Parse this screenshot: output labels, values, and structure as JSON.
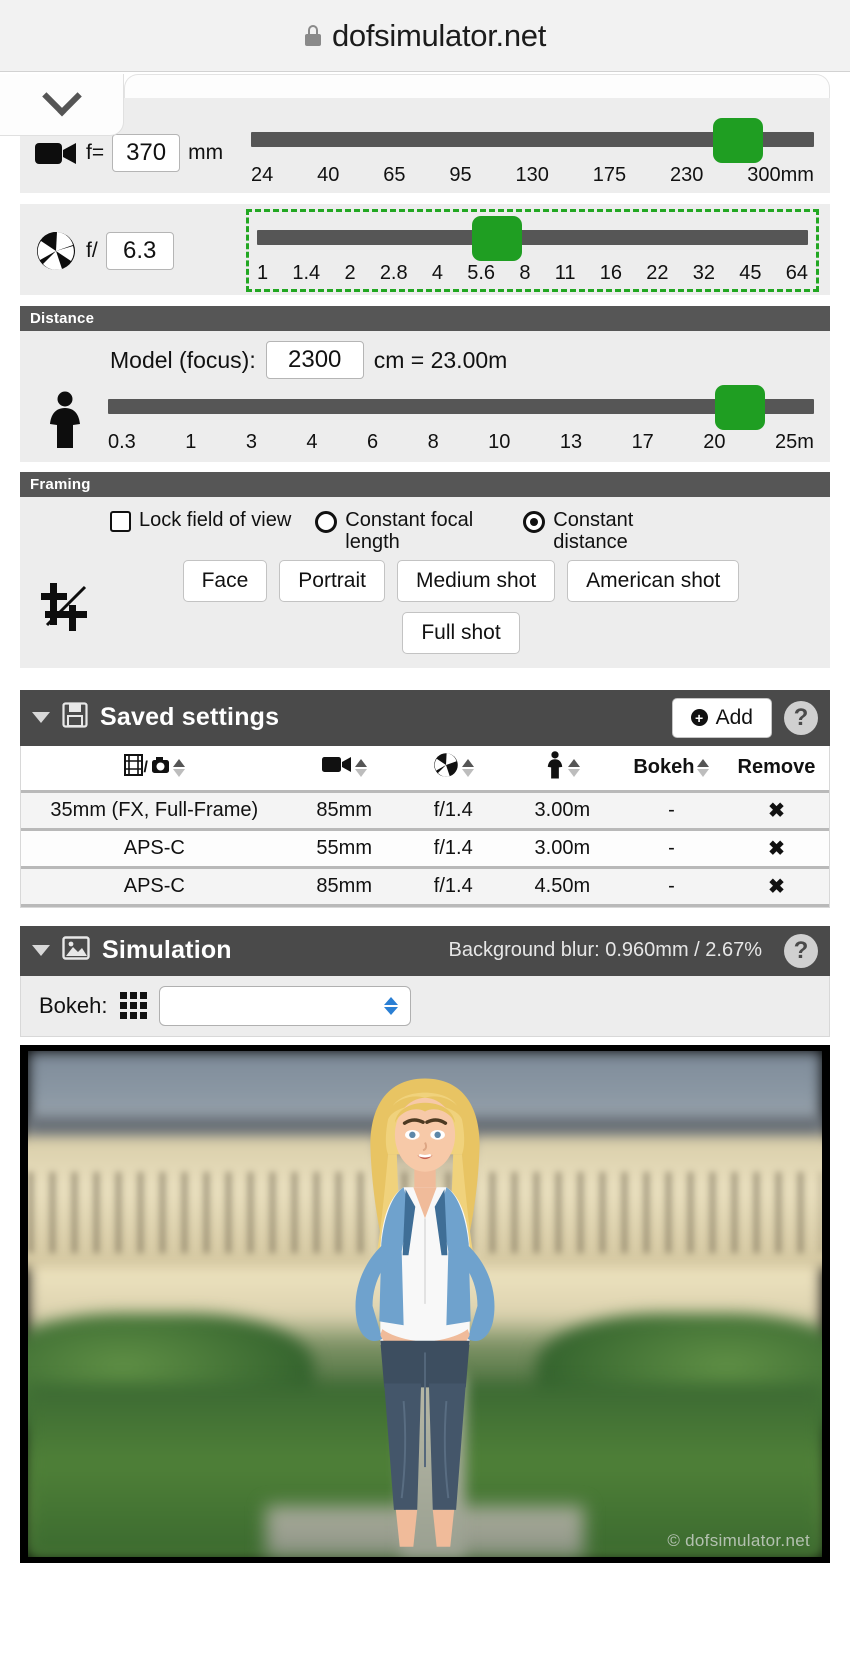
{
  "browser": {
    "lock_icon": "lock-icon",
    "site_title": "dofsimulator.net"
  },
  "focal": {
    "camera_icon": "video-camera-icon",
    "label": "f=",
    "value": "370",
    "unit": "mm",
    "ticks": [
      "24",
      "40",
      "65",
      "95",
      "130",
      "175",
      "230",
      "300mm"
    ],
    "thumb_percent": 92
  },
  "aperture": {
    "aperture_icon": "aperture-icon",
    "label": "f/",
    "value": "6.3",
    "ticks": [
      "1",
      "1.4",
      "2",
      "2.8",
      "4",
      "5.6",
      "8",
      "11",
      "16",
      "22",
      "32",
      "45",
      "64"
    ],
    "thumb_percent": 41,
    "focused": true,
    "focus_color": "#22a722"
  },
  "distance": {
    "section_title": "Distance",
    "person_icon": "person-icon",
    "focus_label": "Model (focus):",
    "value": "2300",
    "unit_text": "cm = 23.00m",
    "ticks": [
      "0.3",
      "1",
      "3",
      "4",
      "6",
      "8",
      "10",
      "13",
      "17",
      "20",
      "25m"
    ],
    "thumb_percent": 90
  },
  "framing": {
    "section_title": "Framing",
    "crop_icon": "crop-icon",
    "lock_fov_label": "Lock field of view",
    "lock_fov_checked": false,
    "constant_focal_label": "Constant focal length",
    "constant_focal_checked": false,
    "constant_distance_label": "Constant distance",
    "constant_distance_checked": true,
    "buttons_row1": [
      "Face",
      "Portrait",
      "Medium shot",
      "American shot"
    ],
    "buttons_row2": [
      "Full shot"
    ]
  },
  "saved_settings": {
    "caret_icon": "caret-down-icon",
    "save_icon": "floppy-disk-icon",
    "title": "Saved settings",
    "add_label": "Add",
    "add_icon": "plus-circle-icon",
    "help_label": "?",
    "columns": [
      {
        "key": "sensor",
        "label": "",
        "icon": "film-camera-icon",
        "sortable": true
      },
      {
        "key": "focal",
        "label": "",
        "icon": "video-camera-icon",
        "sortable": true
      },
      {
        "key": "aperture",
        "label": "",
        "icon": "aperture-icon",
        "sortable": true
      },
      {
        "key": "distance",
        "label": "",
        "icon": "person-icon",
        "sortable": true
      },
      {
        "key": "bokeh",
        "label": "Bokeh",
        "icon": "",
        "sortable": true
      },
      {
        "key": "remove",
        "label": "Remove",
        "icon": "",
        "sortable": false
      }
    ],
    "rows": [
      {
        "sensor": "35mm (FX, Full-Frame)",
        "focal": "85mm",
        "aperture": "f/1.4",
        "distance": "3.00m",
        "bokeh": "-",
        "remove": "✖"
      },
      {
        "sensor": "APS-C",
        "focal": "55mm",
        "aperture": "f/1.4",
        "distance": "3.00m",
        "bokeh": "-",
        "remove": "✖"
      },
      {
        "sensor": "APS-C",
        "focal": "85mm",
        "aperture": "f/1.4",
        "distance": "4.50m",
        "bokeh": "-",
        "remove": "✖"
      }
    ]
  },
  "simulation": {
    "caret_icon": "caret-down-icon",
    "image_icon": "picture-icon",
    "title": "Simulation",
    "blur_info": "Background blur: 0.960mm / 2.67%",
    "help_label": "?",
    "bokeh_label": "Bokeh:",
    "bokeh_grid_icon": "grid-icon",
    "bokeh_selected": "",
    "bokeh_placeholder": "",
    "watermark": "© dofsimulator.net"
  },
  "colors": {
    "slider_track": "#565656",
    "slider_thumb": "#1f9e22",
    "section_header": "#565656",
    "dark_header": "#4a4a4a",
    "panel_bg": "#ededed",
    "focus_outline": "#22a722"
  }
}
